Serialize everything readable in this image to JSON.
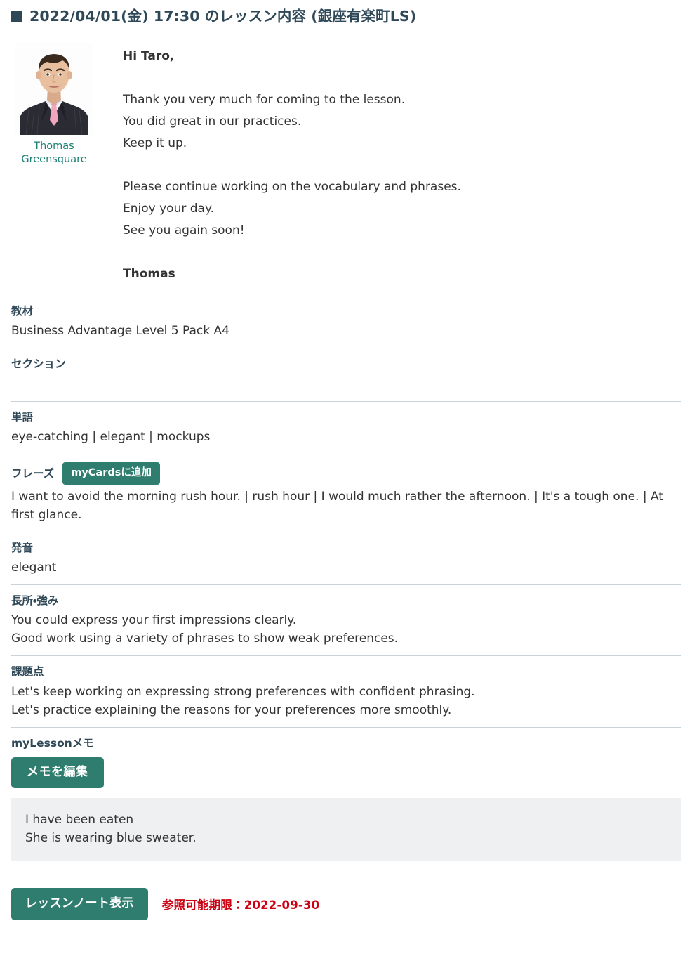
{
  "header": {
    "bullet_icon": "filled-square-icon",
    "title": "2022/04/01(金) 17:30 のレッスン内容 (銀座有楽町LS)"
  },
  "teacher": {
    "avatar_alt": "teacher-photo",
    "name": "Thomas Greensquare"
  },
  "message": {
    "greeting": "Hi Taro,",
    "paragraph1_line1": "Thank you very much for coming to the lesson.",
    "paragraph1_line2": "You did great in our practices.",
    "paragraph1_line3": "Keep it up.",
    "paragraph2_line1": "Please continue working on the vocabulary and phrases.",
    "paragraph2_line2": "Enjoy your day.",
    "paragraph2_line3": "See you again soon!",
    "signature": "Thomas"
  },
  "sections": {
    "material": {
      "label": "教材",
      "value": "Business Advantage Level 5 Pack A4"
    },
    "section": {
      "label": "セクション",
      "value": ""
    },
    "vocabulary": {
      "label": "単語",
      "value": "eye-catching | elegant | mockups"
    },
    "phrases": {
      "label": "フレーズ",
      "add_button": "myCardsに追加",
      "value": "I want to avoid the morning rush hour. | rush hour | I would much rather the afternoon. | It's a tough one. | At first glance."
    },
    "pronunciation": {
      "label": "発音",
      "value": "elegant"
    },
    "strengths": {
      "label": "長所・強み",
      "value": "You could express your first impressions clearly.\nGood work using a variety of phrases to show weak preferences."
    },
    "challenges": {
      "label": "課題点",
      "value": "Let's keep working on expressing strong preferences with confident phrasing.\nLet's practice explaining the reasons for your preferences more smoothly."
    },
    "memo": {
      "label": "myLessonメモ",
      "edit_button": "メモを編集",
      "value": "I have been eaten\nShe is wearing blue sweater."
    }
  },
  "footer": {
    "note_button": "レッスンノート表示",
    "expiry": "参照可能期限：2022-09-30"
  },
  "colors": {
    "accent_green": "#2e7d6e",
    "link_green": "#1b8075",
    "heading_navy": "#2f4858",
    "expiry_red": "#cc0011",
    "divider": "#c7d3d8",
    "memo_bg": "#eff0f2"
  }
}
